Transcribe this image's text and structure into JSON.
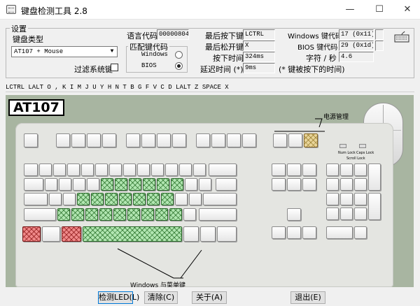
{
  "window": {
    "title": "键盘检测工具 2.8",
    "minimize": "—",
    "maximize": "☐",
    "close": "✕"
  },
  "settings": {
    "group_title": "设置",
    "keyboard_type_label": "键盘类型",
    "keyboard_type_value": "AT107 + Mouse",
    "filter_system_keys_label": "过滤系统键",
    "filter_system_keys_checked": false
  },
  "info": {
    "lang_code_label": "语言代码",
    "lang_code_value": "00000804",
    "match_group_title": "匹配键代码",
    "windows_option": "Windows",
    "bios_option": "BIOS",
    "selected": "BIOS",
    "last_down_label": "最后按下键",
    "last_down_value": "LCTRL",
    "last_up_label": "最后松开键",
    "last_up_value": "X",
    "press_time_label": "按下时间",
    "press_time_value": "324ms",
    "delay_label": "延迟时间 (*)",
    "delay_value": "9ms",
    "delay_note": "(* 键被按下的时间)",
    "windows_code_label": "Windows 键代码",
    "windows_code_value": "17 (0x11)",
    "bios_code_label": "BIOS 键代码",
    "bios_code_value": "29 (0x1d)",
    "rate_label": "字符 / 秒",
    "rate_value": "4.6"
  },
  "key_history": "LCTRL LALT O , K I M J U Y H N T B G F V C D LALT Z SPACE X",
  "keyboard": {
    "model": "AT107",
    "power_mgmt_label": "电源管理",
    "winmenu_label": "Windows 与菜单键",
    "led_labels": [
      "Num Lock",
      "Caps Lock",
      "Scroll Lock"
    ]
  },
  "buttons": {
    "test_led": "检测LED(L)",
    "clear": "清除(C)",
    "about": "关于(A)",
    "exit": "退出(E)"
  },
  "colors": {
    "tested_key": "#b2e6b2",
    "pressed_key": "#f08a8a",
    "power_key": "#e8d49a",
    "panel_bg": "#a8b5a1"
  }
}
